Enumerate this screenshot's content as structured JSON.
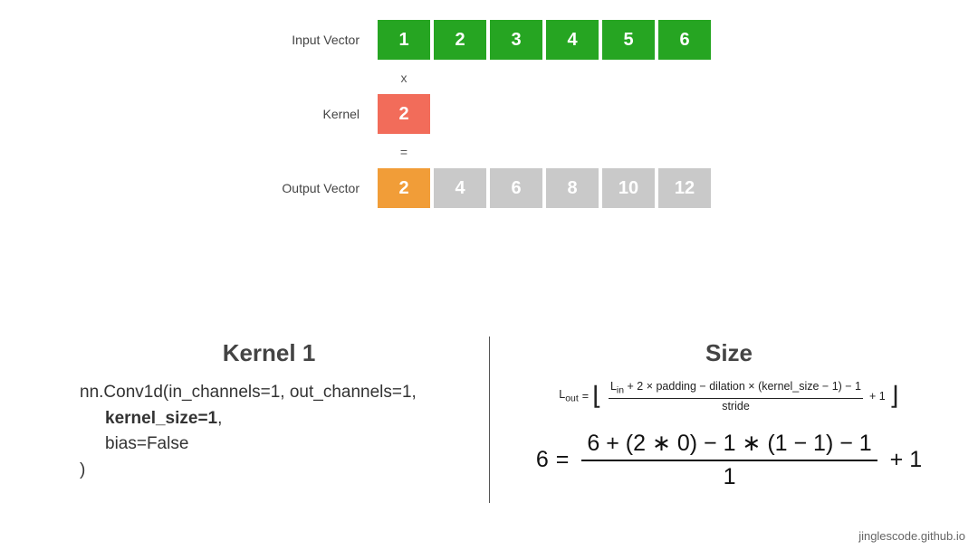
{
  "chart_data": {
    "type": "table",
    "input_vector": [
      1,
      2,
      3,
      4,
      5,
      6
    ],
    "kernel": [
      2
    ],
    "output_vector": [
      2,
      4,
      6,
      8,
      10,
      12
    ],
    "highlighted_output_index": 0,
    "kernel_size": 1,
    "stride": 1,
    "padding": 0,
    "dilation": 1
  },
  "labels": {
    "input": "Input Vector",
    "kernel": "Kernel",
    "output": "Output Vector",
    "times": "x",
    "equals": "="
  },
  "left": {
    "title": "Kernel 1",
    "code_line1_a": "nn.Conv1d(in_channels=1, out_channels=1,",
    "code_line2": "kernel_size=1",
    "code_line2_suffix": ",",
    "code_line3": "bias=False",
    "code_line4": ")"
  },
  "right": {
    "title": "Size",
    "formula_small": {
      "lhs": "L",
      "lhs_sub": "out",
      "eq": "=",
      "num": "Lₗₙ + 2 × padding − dilation × (kernel_size − 1) − 1",
      "num_display_a": "L",
      "num_display_a_sub": "in",
      "num_display_b": " + 2 × padding − dilation × (kernel_size − 1) − 1",
      "den": "stride",
      "tail": "+ 1"
    },
    "formula_big": {
      "lhs": "6",
      "eq": "=",
      "num": "6 + (2 ∗ 0) − 1 ∗ (1 − 1) − 1",
      "den": "1",
      "tail": "+ 1"
    }
  },
  "credit": "jinglescode.github.io"
}
